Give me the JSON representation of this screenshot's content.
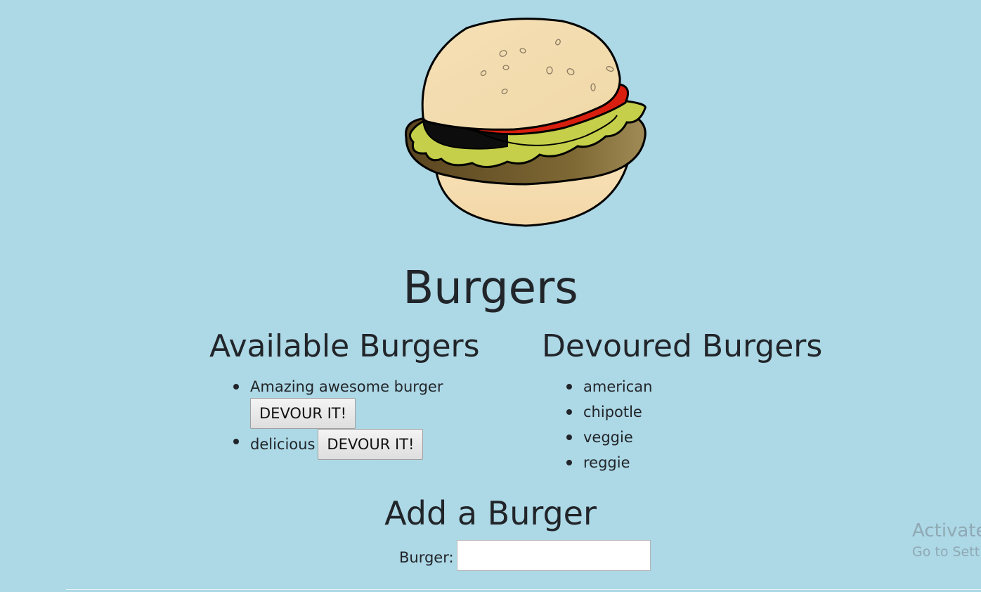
{
  "header": {
    "image_icon": "burger-illustration",
    "title": "Burgers"
  },
  "available": {
    "heading": "Available Burgers",
    "items": [
      {
        "name": "Amazing awesome burger",
        "button_label": "DEVOUR IT!"
      },
      {
        "name": "delicious",
        "button_label": "DEVOUR IT!"
      }
    ]
  },
  "devoured": {
    "heading": "Devoured Burgers",
    "items": [
      "american",
      "chipotle",
      "veggie",
      "reggie"
    ]
  },
  "add_form": {
    "heading": "Add a Burger",
    "label": "Burger:",
    "value": "",
    "placeholder": ""
  },
  "watermark": {
    "line1": "Activate",
    "line2": "Go to Sett"
  },
  "colors": {
    "background": "#add8e6",
    "text": "#212529",
    "button_bg": "#e6e6e6"
  }
}
